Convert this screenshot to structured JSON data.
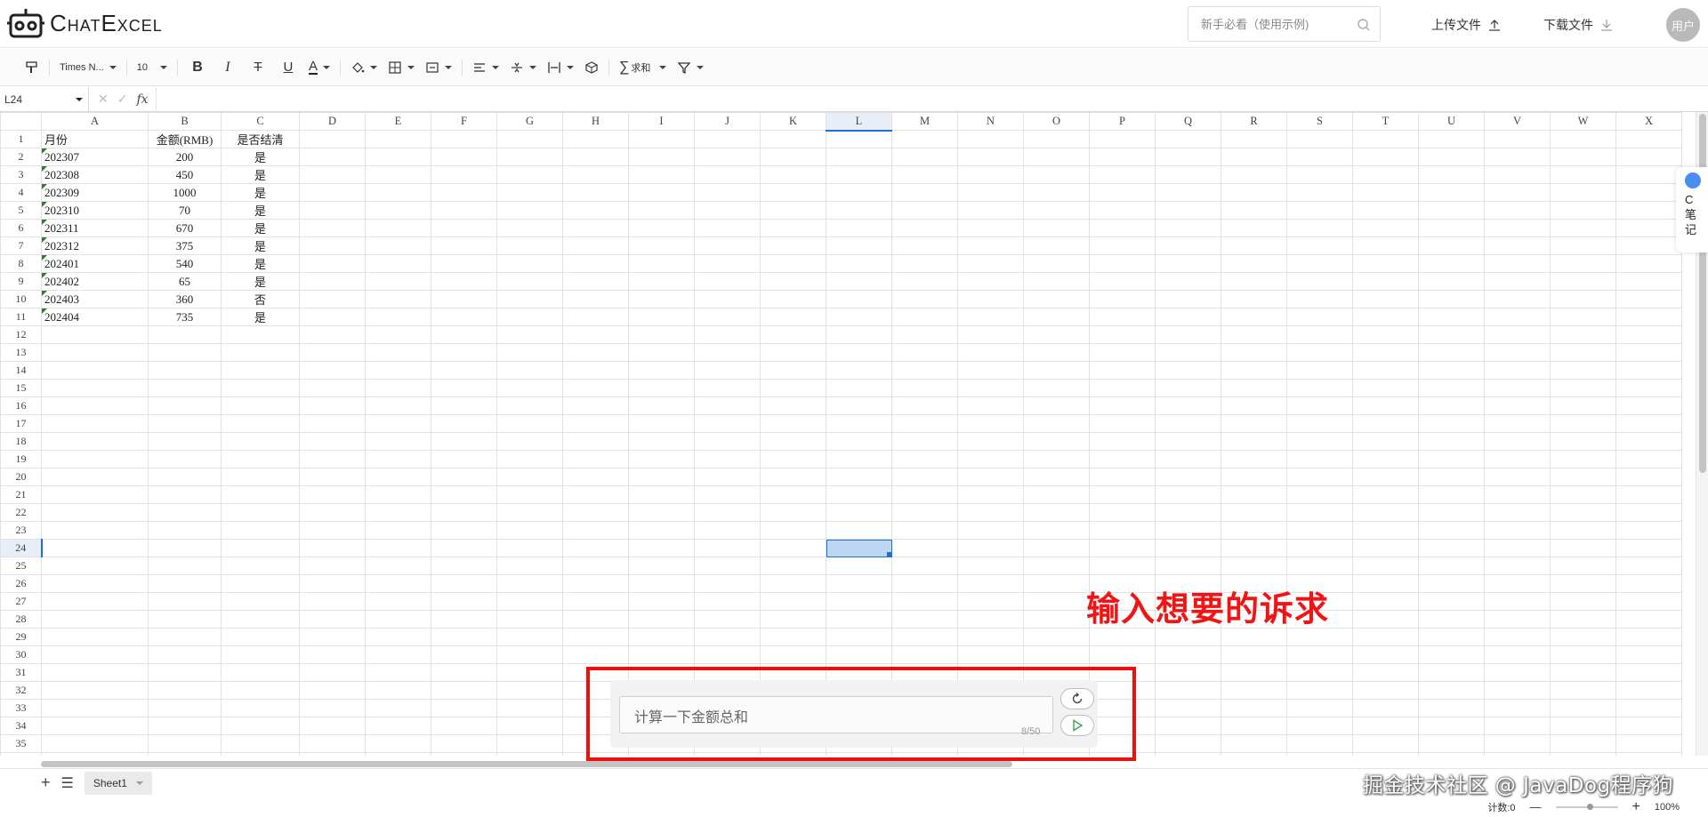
{
  "app": {
    "title": "ChatExcel"
  },
  "header": {
    "search_placeholder": "新手必看（使用示例)",
    "upload_label": "上传文件",
    "download_label": "下载文件",
    "user_label": "用户"
  },
  "toolbar": {
    "font_name": "Times N...",
    "font_size": "10",
    "bold": "B",
    "italic": "I",
    "strike": "T",
    "underline": "U",
    "font_color": "A",
    "sum_label": "求和"
  },
  "formula_bar": {
    "cell_ref": "L24",
    "fx": "fx",
    "formula": ""
  },
  "grid": {
    "columns": [
      "A",
      "B",
      "C",
      "D",
      "E",
      "F",
      "G",
      "H",
      "I",
      "J",
      "K",
      "L",
      "M",
      "N",
      "O",
      "P",
      "Q",
      "R",
      "S",
      "T",
      "U",
      "V",
      "W",
      "X"
    ],
    "selected_column": "L",
    "selected_row": 24,
    "row_count": 36,
    "rows": [
      [
        "月份",
        "金额(RMB)",
        "是否结清"
      ],
      [
        "202307",
        "200",
        "是"
      ],
      [
        "202308",
        "450",
        "是"
      ],
      [
        "202309",
        "1000",
        "是"
      ],
      [
        "202310",
        "70",
        "是"
      ],
      [
        "202311",
        "670",
        "是"
      ],
      [
        "202312",
        "375",
        "是"
      ],
      [
        "202401",
        "540",
        "是"
      ],
      [
        "202402",
        "65",
        "是"
      ],
      [
        "202403",
        "360",
        "否"
      ],
      [
        "202404",
        "735",
        "是"
      ]
    ]
  },
  "side_widget": {
    "line1": "C",
    "line2": "笔",
    "line3": "记"
  },
  "sheet_tabs": {
    "add": "+",
    "menu": "☰",
    "active": "Sheet1"
  },
  "status_bar": {
    "count_label": "计数:0",
    "zoom_minus": "—",
    "zoom_plus": "+",
    "zoom_value": "100%"
  },
  "chat": {
    "value": "计算一下金额总和",
    "counter": "8/50"
  },
  "annotation": {
    "text": "输入想要的诉求"
  },
  "watermark": {
    "text": "掘金技术社区 @ JavaDog程序狗"
  },
  "colors": {
    "accent": "#1f6fd1",
    "annotation_red": "#f01414",
    "selection_fill": "#bcd6f4"
  }
}
